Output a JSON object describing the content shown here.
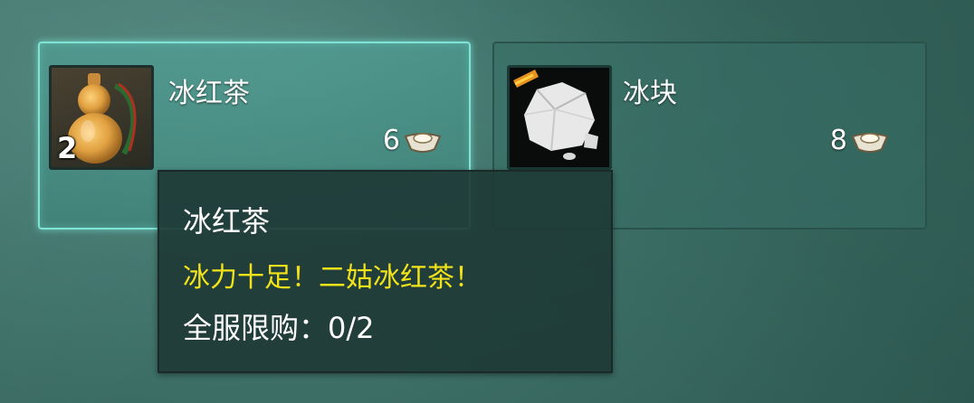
{
  "shop": {
    "items": [
      {
        "name": "冰红茶",
        "price": "6",
        "quantity": "2",
        "icon": "gourd-icon",
        "currency_icon": "silver-ingot-icon",
        "selected": true
      },
      {
        "name": "冰块",
        "price": "8",
        "icon": "ice-block-icon",
        "currency_icon": "silver-ingot-icon",
        "selected": false
      }
    ]
  },
  "tooltip": {
    "title": "冰红茶",
    "description": "冰力十足！二姑冰红茶！",
    "limit": "全服限购：0/2"
  },
  "colors": {
    "selected_border": "#7fe3d5",
    "description_text": "#f2e21a",
    "background": "#3c7268"
  }
}
